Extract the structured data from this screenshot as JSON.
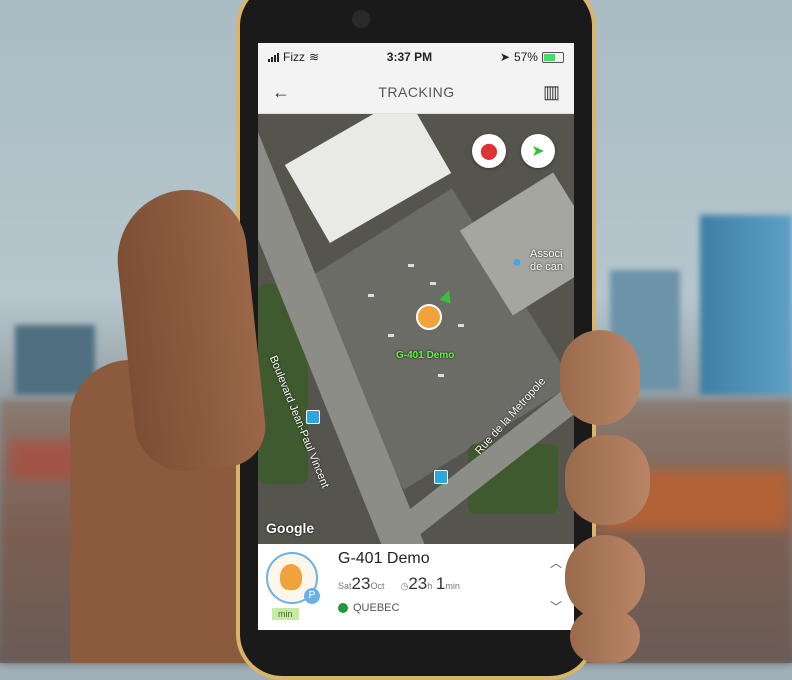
{
  "status_bar": {
    "carrier": "Fizz",
    "time": "3:37 PM",
    "battery": "57%"
  },
  "header": {
    "title": "TRACKING",
    "back_icon": "back-arrow-icon",
    "map_icon": "map-icon"
  },
  "map": {
    "road_labels": [
      "Boulevard Jean-Paul Vincent",
      "Rue de la Metropole"
    ],
    "poi_label": "Associ\nde can",
    "vehicle_label": "G-401 Demo",
    "google_logo": "Google"
  },
  "device_card": {
    "name": "G-401 Demo",
    "date_small": "Sat",
    "date_day": "23",
    "date_month": "Oct",
    "duration_hours": "23",
    "duration_h_unit": "h",
    "duration_minutes": "1",
    "duration_min_unit": "min",
    "location": "QUEBEC",
    "tag": "min",
    "colors": {
      "status_dot": "#1e9a3b",
      "avatar_ring": "#6cb0e6"
    }
  }
}
